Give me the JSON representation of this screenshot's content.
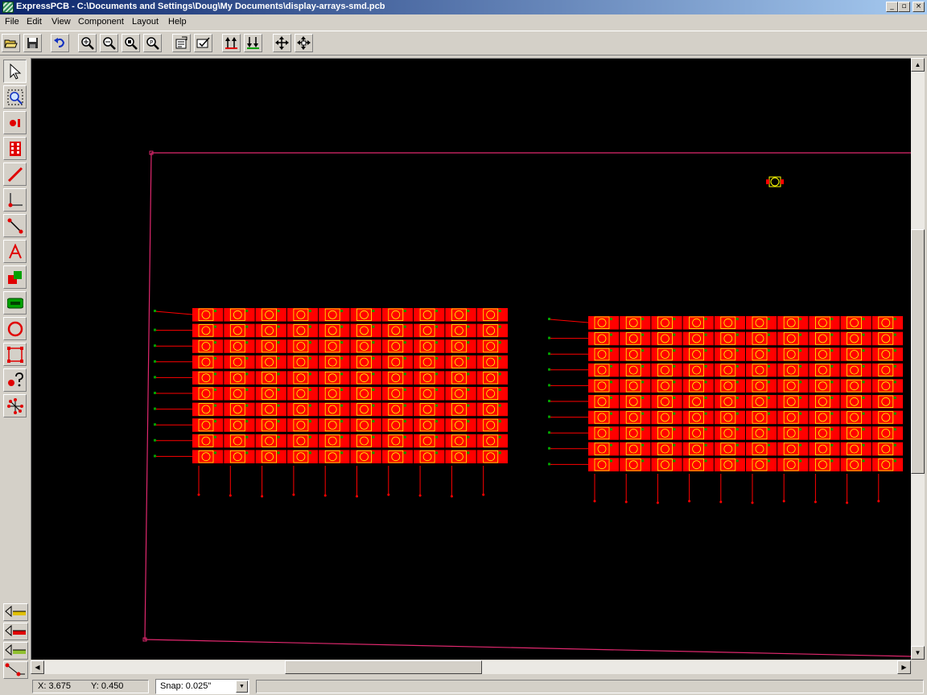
{
  "window": {
    "title": "ExpressPCB - C:\\Documents and Settings\\Doug\\My Documents\\display-arrays-smd.pcb",
    "app_icon": "expresspcb-icon",
    "controls": {
      "minimize": "_",
      "maximize": "▫",
      "close": "×"
    }
  },
  "menu": {
    "items": [
      "File",
      "Edit",
      "View",
      "Component",
      "Layout",
      "Help"
    ]
  },
  "toolbar": {
    "buttons": [
      "open-icon",
      "save-icon",
      "undo-icon",
      "zoom-in-icon",
      "zoom-out-icon",
      "zoom-fit-icon",
      "zoom-previous-icon",
      "properties-icon",
      "check-icon",
      "top-layer-icon",
      "bottom-layer-icon",
      "move-icon",
      "move-all-icon"
    ]
  },
  "palette": {
    "tools": [
      "pointer-icon",
      "zoom-window-icon",
      "pad-icon",
      "component-icon",
      "trace-icon",
      "angle-trace-icon",
      "rats-nest-icon",
      "text-icon",
      "filled-plane-icon",
      "plane-shape-icon",
      "circle-icon",
      "board-outline-icon",
      "query-icon",
      "net-icon"
    ],
    "layers": [
      "top-layer-visibility-icon",
      "bottom-layer-visibility-icon",
      "silkscreen-visibility-icon",
      "ratsnest-visibility-icon"
    ]
  },
  "canvas": {
    "background": "#000000",
    "board_outline_color": "#e0286e",
    "copper_color": "#ff0000",
    "silk_color": "#ffff00",
    "pad_marker_color": "#00a000",
    "array_left": {
      "rows": 10,
      "cols": 10
    },
    "array_right": {
      "rows": 10,
      "cols": 10
    }
  },
  "status": {
    "x": "X: 3.675",
    "y": "Y: 0.450",
    "snap": "Snap:  0.025\""
  }
}
